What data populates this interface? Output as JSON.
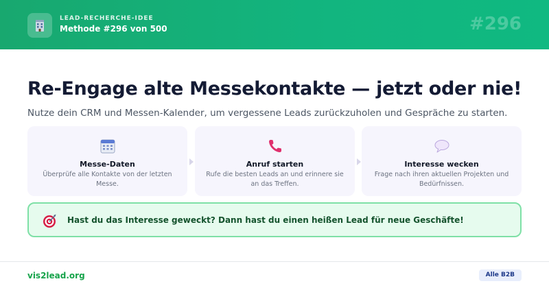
{
  "header": {
    "icon": "office-building-icon",
    "kicker": "LEAD-RECHERCHE-IDEE",
    "title": "Methode #296 von 500",
    "number": "#296"
  },
  "main": {
    "headline": "Re-Engage alte Messekontakte — jetzt oder nie!",
    "subline": "Nutze dein CRM und Messen-Kalender, um vergessene Leads zurückzuholen und Gespräche zu starten."
  },
  "steps": [
    {
      "icon": "calendar-icon",
      "title": "Messe-Daten",
      "description": "Überprüfe alle Kontakte von der letzten Messe."
    },
    {
      "icon": "phone-icon",
      "title": "Anruf starten",
      "description": "Rufe die besten Leads an und erinnere sie an das Treffen."
    },
    {
      "icon": "speech-bubble-icon",
      "title": "Interesse wecken",
      "description": "Frage nach ihren aktuellen Projekten und Bedürfnissen."
    }
  ],
  "callout": {
    "icon": "target-icon",
    "text": "Hast du das Interesse geweckt? Dann hast du einen heißen Lead für neue Geschäfte!"
  },
  "footer": {
    "brand": "vis2lead.org",
    "badge": "Alle B2B"
  },
  "colors": {
    "header_green": "#12b57f",
    "headline": "#141b34",
    "callout_bg": "#e6fbee",
    "callout_border": "#7ee0a6",
    "brand_green": "#16a34a"
  }
}
